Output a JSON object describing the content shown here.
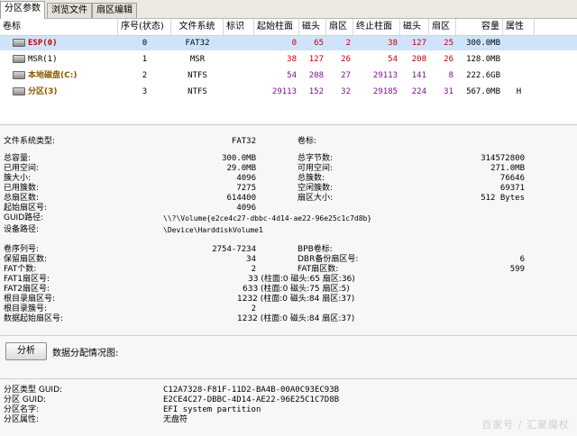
{
  "tabs": [
    {
      "label": "分区参数",
      "active": true
    },
    {
      "label": "浏览文件",
      "active": false
    },
    {
      "label": "扇区编辑",
      "active": false
    }
  ],
  "table": {
    "columns": [
      "卷标",
      "序号(状态)",
      "文件系统",
      "标识",
      "起始柱面",
      "磁头",
      "扇区",
      "终止柱面",
      "磁头",
      "扇区",
      "容量",
      "属性"
    ],
    "rows": [
      {
        "name": "ESP(0)",
        "index": "0",
        "fs": "FAT32",
        "flag": "",
        "start_cyl": "0",
        "start_head": "65",
        "start_sec": "2",
        "end_cyl": "38",
        "end_head": "127",
        "end_sec": "25",
        "size": "300.0MB",
        "attr": ""
      },
      {
        "name": "MSR(1)",
        "index": "1",
        "fs": "MSR",
        "flag": "",
        "start_cyl": "38",
        "start_head": "127",
        "start_sec": "26",
        "end_cyl": "54",
        "end_head": "208",
        "end_sec": "26",
        "size": "128.0MB",
        "attr": ""
      },
      {
        "name": "本地磁盘(C:)",
        "index": "2",
        "fs": "NTFS",
        "flag": "",
        "start_cyl": "54",
        "start_head": "208",
        "start_sec": "27",
        "end_cyl": "29113",
        "end_head": "141",
        "end_sec": "8",
        "size": "222.6GB",
        "attr": ""
      },
      {
        "name": "分区(3)",
        "index": "3",
        "fs": "NTFS",
        "flag": "",
        "start_cyl": "29113",
        "start_head": "152",
        "start_sec": "32",
        "end_cyl": "29185",
        "end_head": "224",
        "end_sec": "31",
        "size": "567.0MB",
        "attr": "H"
      }
    ]
  },
  "details": {
    "fs_type_label": "文件系统类型:",
    "fs_type_value": "FAT32",
    "volume_label_label": "卷标:",
    "total_cap_label": "总容量:",
    "total_cap_value": "300.0MB",
    "total_bytes_label": "总字节数:",
    "total_bytes_value": "314572800",
    "used_label": "已用空间:",
    "used_value": "29.0MB",
    "free_label": "可用空间:",
    "free_value": "271.0MB",
    "cluster_size_label": "簇大小:",
    "cluster_size_value": "4096",
    "total_clusters_label": "总簇数:",
    "total_clusters_value": "76646",
    "used_clusters_label": "已用簇数:",
    "used_clusters_value": "7275",
    "free_clusters_label": "空闲簇数:",
    "free_clusters_value": "69371",
    "total_sectors_label": "总扇区数:",
    "total_sectors_value": "614400",
    "sector_size_label": "扇区大小:",
    "sector_size_value": "512 Bytes",
    "start_sector_label": "起始扇区号:",
    "start_sector_value": "4096",
    "guid_path_label": "GUID路径:",
    "guid_path_value": "\\\\?\\Volume{e2ce4c27-dbbc-4d14-ae22-96e25c1c7d8b}",
    "device_path_label": "设备路径:",
    "device_path_value": "\\Device\\HarddiskVolume1",
    "serial_label": "卷序列号:",
    "serial_value": "2754-7234",
    "bpb_label": "BPB卷标:",
    "reserved_label": "保留扇区数:",
    "reserved_value": "34",
    "dbr_backup_label": "DBR备份扇区号:",
    "dbr_backup_value": "6",
    "fat_count_label": "FAT个数:",
    "fat_count_value": "2",
    "fat_sectors_label": "FAT扇区数:",
    "fat_sectors_value": "599",
    "fat1_label": "FAT1扇区号:",
    "fat1_value": "33 (柱面:0 磁头:65 扇区:36)",
    "fat2_label": "FAT2扇区号:",
    "fat2_value": "633 (柱面:0 磁头:75 扇区:5)",
    "root_sector_label": "根目录扇区号:",
    "root_sector_value": "1232 (柱面:0 磁头:84 扇区:37)",
    "root_cluster_label": "根目录簇号:",
    "root_cluster_value": "2",
    "data_start_label": "数据起始扇区号:",
    "data_start_value": "1232 (柱面:0 磁头:84 扇区:37)"
  },
  "analyze_button": "分析",
  "distribution_label": "数据分配情况图:",
  "guids": {
    "type_guid_label": "分区类型 GUID:",
    "type_guid_value": "C12A7328-F81F-11D2-BA4B-00A0C93EC93B",
    "part_guid_label": "分区 GUID:",
    "part_guid_value": "E2CE4C27-DBBC-4D14-AE22-96E25C1C7D8B",
    "part_name_label": "分区名字:",
    "part_name_value": "EFI system partition",
    "part_attr_label": "分区属性:",
    "part_attr_value": "无盘符"
  },
  "watermark": "百家号 / 汇聚魔杖",
  "colors": {
    "red": "#c00000",
    "purple": "#7a0f8a",
    "selection": "#cfe4fb"
  }
}
